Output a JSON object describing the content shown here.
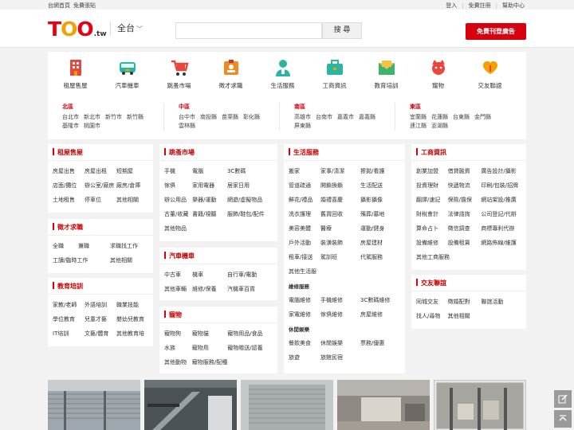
{
  "topbar": {
    "home": "台網首頁",
    "free_post": "免費張貼",
    "login": "登入",
    "register": "免費註冊",
    "help": "幫助中心"
  },
  "header": {
    "logo_main": "TOO",
    "logo_suffix": ".tw",
    "region_label": "全台",
    "search_placeholder": "",
    "search_button": "搜 尋",
    "post_button": "免費刊登廣告"
  },
  "categories": [
    {
      "label": "租屋售屋",
      "icon": "building-icon",
      "color": "#e8473c"
    },
    {
      "label": "汽車機車",
      "icon": "bus-icon",
      "color": "#2bb5a0"
    },
    {
      "label": "跳蚤市場",
      "icon": "cart-icon",
      "color": "#e8473c"
    },
    {
      "label": "徵才求職",
      "icon": "id-badge-icon",
      "color": "#f08a24"
    },
    {
      "label": "生活服務",
      "icon": "person-service-icon",
      "color": "#2bb5a0"
    },
    {
      "label": "工商資訊",
      "icon": "briefcase-icon",
      "color": "#2bb5a0"
    },
    {
      "label": "教育培訓",
      "icon": "envelope-icon",
      "color": "#3cb371"
    },
    {
      "label": "寵物",
      "icon": "pet-icon",
      "color": "#e8473c"
    },
    {
      "label": "交友聯誼",
      "icon": "heart-hand-icon",
      "color": "#f5a000"
    }
  ],
  "regions": [
    {
      "title": "北區",
      "cities": [
        "台北市",
        "新北市",
        "新竹市",
        "新竹縣",
        "基隆市",
        "桃園市"
      ]
    },
    {
      "title": "中區",
      "cities": [
        "台中市",
        "南投縣",
        "苗栗縣",
        "彰化縣",
        "雲林縣"
      ]
    },
    {
      "title": "南區",
      "cities": [
        "高雄市",
        "台南市",
        "嘉義市",
        "嘉義縣",
        "屏東縣"
      ]
    },
    {
      "title": "東區",
      "cities": [
        "宜蘭縣",
        "花蓮縣",
        "台東縣",
        "金門縣",
        "連江縣",
        "澎湖縣"
      ]
    }
  ],
  "panels": {
    "rent": {
      "title": "租屋售屋",
      "items": [
        "房屋出售",
        "房屋出租",
        "短期屋",
        "店面/攤位",
        "辦公室/廠房",
        "廠房/倉庫",
        "土地租售",
        "停車位",
        "其他相關"
      ]
    },
    "job": {
      "title": "徵才求職",
      "items": [
        "全職",
        "兼職",
        "求職找工作",
        "工讀/臨時工作",
        "其他相關"
      ]
    },
    "edu": {
      "title": "教育培訓",
      "items": [
        "家教/老師",
        "外語培訓",
        "職業技能",
        "學位教育",
        "兒童才藝",
        "嬰幼兒教育",
        "IT培訓",
        "文藝/體育",
        "其他教育培"
      ]
    },
    "flea": {
      "title": "跳蚤市場",
      "items": [
        "手機",
        "電腦",
        "3C數碼",
        "傢俱",
        "家用電器",
        "居家日用",
        "辦公用品",
        "樂器/運動",
        "網遊/虛擬物品",
        "古董/收藏",
        "書籍/視聽",
        "服飾/鞋包/配件",
        "其他物品"
      ]
    },
    "car": {
      "title": "汽車機車",
      "items": [
        "中古車",
        "機車",
        "自行車/電動",
        "其他車輛",
        "維修/保養",
        "汽機車百貨"
      ]
    },
    "pet": {
      "title": "寵物",
      "items": [
        "寵物狗",
        "寵物貓",
        "寵物用品/食品",
        "水族",
        "寵物鳥",
        "寵物贈送/認養",
        "其他動物",
        "寵物服務/配種"
      ]
    },
    "life": {
      "title": "生活服務",
      "items": [
        "搬家",
        "家事/清潔",
        "擦拋/看護",
        "管道疏通",
        "開鎖換鎖",
        "生活配送",
        "鮮花/禮品",
        "婚禮喜慶",
        "攝影攝像",
        "洗衣護理",
        "舊貨回收",
        "殯葬/墓地",
        "美容美體",
        "醫療",
        "運動/健身",
        "戶外活動",
        "裝潢裝飾",
        "房屋建材",
        "租車/接送",
        "駕訓班",
        "代駕服務",
        "其他生活服"
      ],
      "repair_title": "維修服務",
      "repair_items": [
        "電腦維修",
        "手機維修",
        "3C數碼維修",
        "家電維修",
        "傢俱維修",
        "房屋維修"
      ],
      "leisure_title": "休閒娛樂",
      "leisure_items": [
        "餐飲美食",
        "休閒娛樂",
        "票務/優惠",
        "旅遊",
        "旅館民宿"
      ]
    },
    "biz": {
      "title": "工商資訊",
      "items": [
        "創業加盟",
        "借貸融資",
        "廣告設計/攝影",
        "投資理財",
        "快遞物流",
        "印刷/包裝/招牌",
        "翻譯/速記",
        "保險/擔保",
        "網站架設/推廣",
        "財稅會計",
        "法律諮詢",
        "公司登記/代辦",
        "算命占卜",
        "徵信調查",
        "商標專利代辦",
        "設備維修",
        "設備租賃",
        "網路佈線/維護",
        "其他工商服務"
      ]
    },
    "dating": {
      "title": "交友聯誼",
      "items": [
        "同城交友",
        "徵婚配對",
        "聯誼活動",
        "找人/尋物",
        "其他相關"
      ]
    }
  }
}
